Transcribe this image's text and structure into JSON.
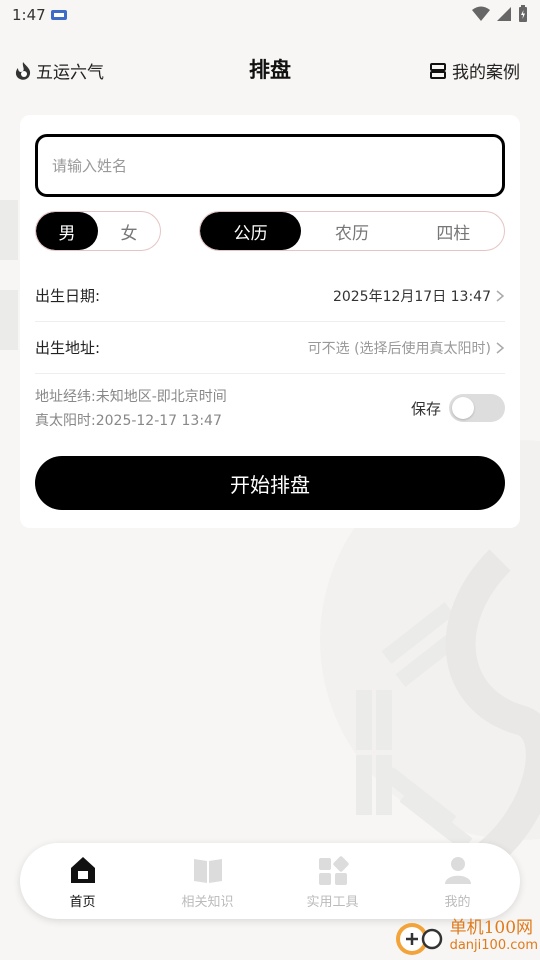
{
  "status_bar": {
    "time": "1:47"
  },
  "header": {
    "brand_label": "五运六气",
    "title": "排盘",
    "cases_label": "我的案例",
    "icons": {
      "brand": "flame-swirl-icon",
      "cases": "folder-icon"
    }
  },
  "form": {
    "name_placeholder": "请输入姓名",
    "name_value": "",
    "gender": {
      "options": [
        "男",
        "女"
      ],
      "selected": "男"
    },
    "calendar": {
      "options": [
        "公历",
        "农历",
        "四柱"
      ],
      "selected": "公历"
    },
    "birth_date": {
      "label": "出生日期:",
      "value": "2025年12月17日 13:47"
    },
    "birth_place": {
      "label": "出生地址:",
      "value": "可不选 (选择后使用真太阳时)"
    },
    "location_info": "地址经纬:未知地区-即北京时间",
    "solar_time": "真太阳时:2025-12-17 13:47",
    "save_label": "保存",
    "save_enabled": false,
    "start_label": "开始排盘"
  },
  "bottom_nav": [
    {
      "label": "首页",
      "icon": "home-icon",
      "active": true
    },
    {
      "label": "相关知识",
      "icon": "book-icon",
      "active": false
    },
    {
      "label": "实用工具",
      "icon": "tools-icon",
      "active": false
    },
    {
      "label": "我的",
      "icon": "user-icon",
      "active": false
    }
  ],
  "watermark": {
    "title": "单机100网",
    "sub": "danji100.com"
  },
  "colors": {
    "accent": "#000000",
    "page_bg": "#f7f6f4",
    "watermark": "#e07a1a"
  }
}
